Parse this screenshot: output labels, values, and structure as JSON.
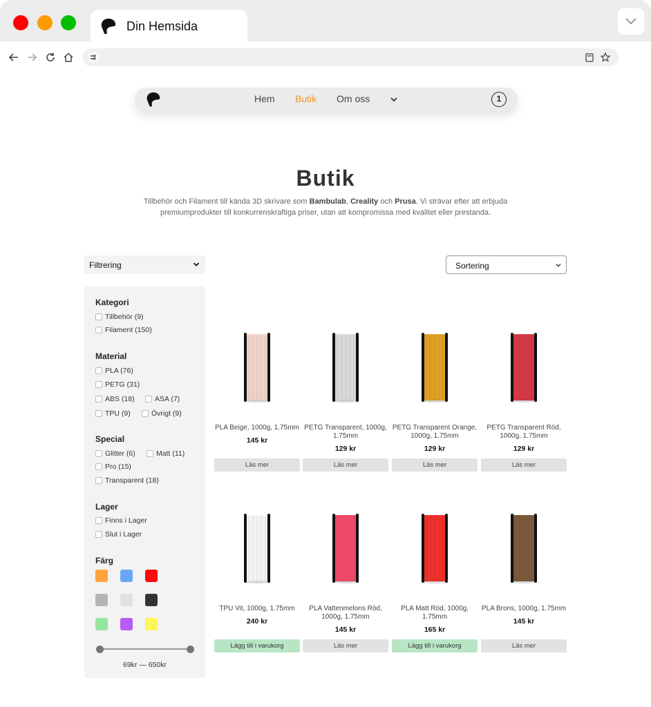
{
  "browser": {
    "tab_title": "Din Hemsida",
    "url": ""
  },
  "nav": {
    "links": [
      {
        "label": "Hem",
        "active": false
      },
      {
        "label": "Butik",
        "active": true
      },
      {
        "label": "Om oss",
        "active": false
      }
    ],
    "cart_count": "1",
    "accent_color": "#f0962e"
  },
  "hero": {
    "title": "Butik",
    "desc_1": "Tillbehör och Filament till kända 3D skrivare som ",
    "brand_1": "Bambulab",
    "desc_2": ", ",
    "brand_2": "Creality",
    "desc_3": " och ",
    "brand_3": "Prusa",
    "desc_4": ". Vi strävar efter att erbjuda premiumprodukter till konkurrenskraftiga priser, utan att kompromissa med kvalitet eller prestanda."
  },
  "controls": {
    "filter_label": "Filtrering",
    "sort_label": "Sortering"
  },
  "sidebar": {
    "category_heading": "Kategori",
    "categories": [
      "Tillbehör (9)",
      "Filament (150)"
    ],
    "material_heading": "Material",
    "materials": [
      "PLA (76)",
      "PETG (31)",
      "ABS (18)",
      "ASA (7)",
      "TPU (9)",
      "Övrigt (9)"
    ],
    "special_heading": "Special",
    "specials": [
      "Glitter (6)",
      "Matt (11)",
      "Pro (15)",
      "Transparent (18)"
    ],
    "stock_heading": "Lager",
    "stock": [
      "Finns i Lager",
      "Slut i Lager"
    ],
    "color_heading": "Färg",
    "colors": [
      "#ffa23a",
      "#6aa6f5",
      "#ff0a0a",
      "#b5b5b5",
      "#e1e1e1",
      "#333333",
      "#94e69c",
      "#b85cf5",
      "#fcf55a"
    ],
    "price_range": "69kr — 650kr"
  },
  "products": [
    {
      "name": "PLA Beige, 1000g, 1.75mm",
      "price": "145 kr",
      "button": "Läs mer",
      "in_cart_style": false,
      "spool_color": "#efd3c8"
    },
    {
      "name": "PETG Transparent, 1000g, 1.75mm",
      "price": "129 kr",
      "button": "Läs mer",
      "in_cart_style": false,
      "spool_color": "#d8d8d8"
    },
    {
      "name": "PETG Transparent Orange, 1000g, 1.75mm",
      "price": "129 kr",
      "button": "Läs mer",
      "in_cart_style": false,
      "spool_color": "#e0a023"
    },
    {
      "name": "PETG Transparent Röd, 1000g, 1.75mm",
      "price": "129 kr",
      "button": "Läs mer",
      "in_cart_style": false,
      "spool_color": "#d43a44"
    },
    {
      "name": "TPU Vit, 1000g, 1.75mm",
      "price": "240 kr",
      "button": "Lägg till i varukorg",
      "in_cart_style": true,
      "spool_color": "#f4f4f4"
    },
    {
      "name": "PLA Vattenmelons Röd, 1000g, 1.75mm",
      "price": "145 kr",
      "button": "Läs mer",
      "in_cart_style": false,
      "spool_color": "#f04a6a"
    },
    {
      "name": "PLA Matt Röd, 1000g, 1.75mm",
      "price": "165 kr",
      "button": "Lägg till i varukorg",
      "in_cart_style": true,
      "spool_color": "#f0302a"
    },
    {
      "name": "PLA Brons, 1000g, 1.75mm",
      "price": "145 kr",
      "button": "Läs mer",
      "in_cart_style": false,
      "spool_color": "#7a5a3a"
    }
  ]
}
